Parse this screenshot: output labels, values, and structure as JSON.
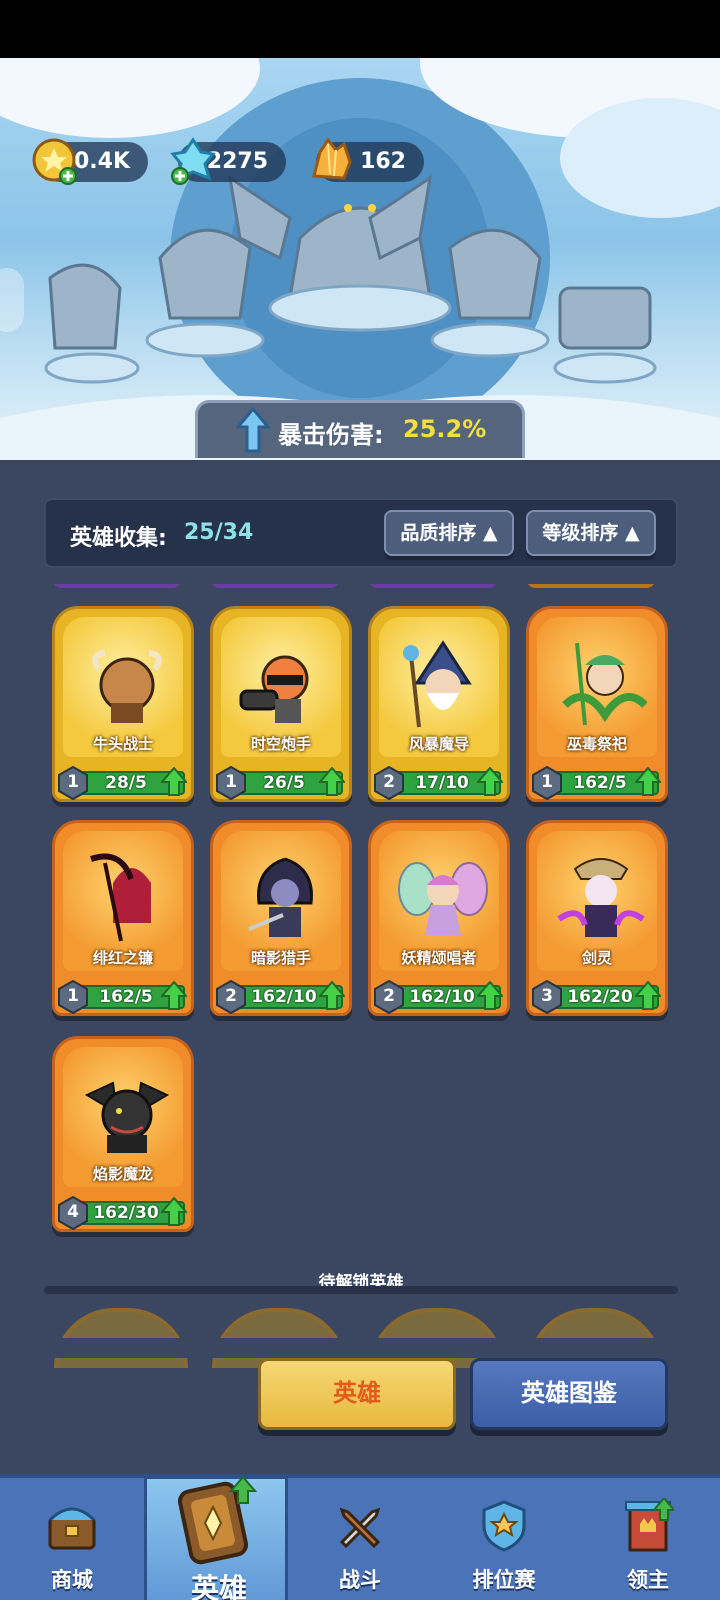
{
  "resources": [
    {
      "id": "gold",
      "value": "10.4K",
      "icon": "gold-coin-icon"
    },
    {
      "id": "crystal",
      "value": "2275",
      "icon": "ice-crystal-icon"
    },
    {
      "id": "amber",
      "value": "162",
      "icon": "amber-crystal-icon"
    }
  ],
  "buff": {
    "label": "暴击伤害:",
    "value": "25.2%"
  },
  "collection": {
    "label": "英雄收集:",
    "count": "25/34"
  },
  "sort": {
    "quality": "品质排序",
    "level": "等级排序"
  },
  "heroes": [
    {
      "name": "牛头战士",
      "level": "1",
      "progress": "28/5",
      "rarity": "gold",
      "portrait": "minotaur"
    },
    {
      "name": "时空炮手",
      "level": "1",
      "progress": "26/5",
      "rarity": "gold",
      "portrait": "gunner"
    },
    {
      "name": "风暴魔导",
      "level": "2",
      "progress": "17/10",
      "rarity": "gold",
      "portrait": "wizard"
    },
    {
      "name": "巫毒祭祀",
      "level": "1",
      "progress": "162/5",
      "rarity": "orange",
      "portrait": "voodoo"
    },
    {
      "name": "绯红之镰",
      "level": "1",
      "progress": "162/5",
      "rarity": "orange",
      "portrait": "scythe"
    },
    {
      "name": "暗影猎手",
      "level": "2",
      "progress": "162/10",
      "rarity": "orange",
      "portrait": "hunter"
    },
    {
      "name": "妖精颂唱者",
      "level": "2",
      "progress": "162/10",
      "rarity": "orange",
      "portrait": "fairy"
    },
    {
      "name": "剑灵",
      "level": "3",
      "progress": "162/20",
      "rarity": "orange",
      "portrait": "swordspirit"
    },
    {
      "name": "焰影魔龙",
      "level": "4",
      "progress": "162/30",
      "rarity": "orange",
      "portrait": "dragon"
    }
  ],
  "locked_title": "待解锁英雄",
  "buttons": {
    "hero": "英雄",
    "codex": "英雄图鉴"
  },
  "nav": [
    {
      "label": "商城",
      "icon": "shop-chest-icon"
    },
    {
      "label": "英雄",
      "icon": "hero-card-icon"
    },
    {
      "label": "战斗",
      "icon": "battle-swords-icon"
    },
    {
      "label": "排位赛",
      "icon": "ranked-shield-icon"
    },
    {
      "label": "领主",
      "icon": "lord-banner-icon"
    }
  ],
  "colors": {
    "gold_card": "#e7b524",
    "orange_card": "#f08c2a",
    "buff_value": "#f4df3c",
    "count": "#8fe0e8",
    "progress_bar": "#2fa33f"
  }
}
